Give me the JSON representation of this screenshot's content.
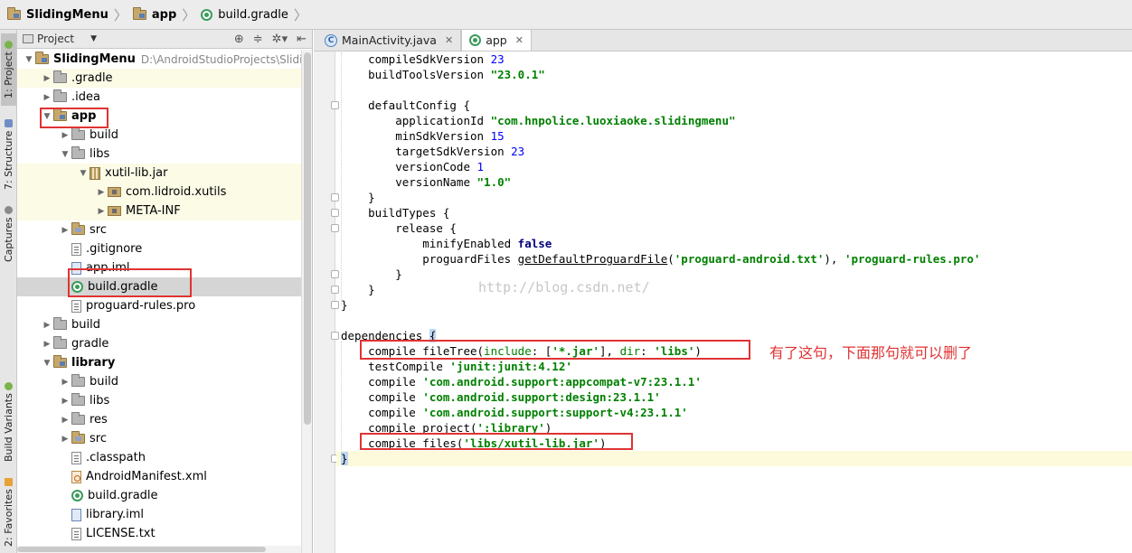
{
  "breadcrumb": {
    "items": [
      {
        "label": "SlidingMenu",
        "icon": "module-folder-icon"
      },
      {
        "label": "app",
        "icon": "module-folder-icon"
      },
      {
        "label": "build.gradle",
        "icon": "gradle-icon"
      }
    ]
  },
  "left_toolbar": {
    "tabs": [
      {
        "label": "1: Project",
        "active": true
      },
      {
        "label": "7: Structure"
      },
      {
        "label": "Captures"
      },
      {
        "label": "Build Variants"
      },
      {
        "label": "2: Favorites"
      }
    ]
  },
  "project_panel": {
    "view_selector": "Project",
    "tree": [
      {
        "label": "SlidingMenu",
        "path": "D:\\AndroidStudioProjects\\Sliding",
        "expanded": true,
        "bold": true,
        "icon": "module-folder-icon"
      },
      {
        "label": ".gradle",
        "icon": "folder-icon",
        "expanded": false
      },
      {
        "label": ".idea",
        "icon": "folder-icon",
        "expanded": false
      },
      {
        "label": "app",
        "icon": "module-folder-icon",
        "expanded": true,
        "bold": true
      },
      {
        "label": "build",
        "icon": "folder-icon",
        "expanded": false
      },
      {
        "label": "libs",
        "icon": "folder-icon",
        "expanded": true
      },
      {
        "label": "xutil-lib.jar",
        "icon": "jar-icon",
        "expanded": true
      },
      {
        "label": "com.lidroid.xutils",
        "icon": "package-icon",
        "expanded": false
      },
      {
        "label": "META-INF",
        "icon": "package-icon",
        "expanded": false
      },
      {
        "label": "src",
        "icon": "source-folder-icon",
        "expanded": false
      },
      {
        "label": ".gitignore",
        "icon": "text-file-icon"
      },
      {
        "label": "app.iml",
        "icon": "iml-file-icon"
      },
      {
        "label": "build.gradle",
        "icon": "gradle-icon",
        "selected": true
      },
      {
        "label": "proguard-rules.pro",
        "icon": "text-file-icon"
      },
      {
        "label": "build",
        "icon": "folder-icon",
        "expanded": false
      },
      {
        "label": "gradle",
        "icon": "folder-icon",
        "expanded": false
      },
      {
        "label": "library",
        "icon": "module-folder-icon",
        "expanded": true,
        "bold": true
      },
      {
        "label": "build",
        "icon": "folder-icon",
        "expanded": false
      },
      {
        "label": "libs",
        "icon": "folder-icon",
        "expanded": false
      },
      {
        "label": "res",
        "icon": "folder-icon",
        "expanded": false
      },
      {
        "label": "src",
        "icon": "source-folder-icon",
        "expanded": false
      },
      {
        "label": ".classpath",
        "icon": "text-file-icon"
      },
      {
        "label": "AndroidManifest.xml",
        "icon": "xml-file-icon"
      },
      {
        "label": "build.gradle",
        "icon": "gradle-icon"
      },
      {
        "label": "library.iml",
        "icon": "iml-file-icon"
      },
      {
        "label": "LICENSE.txt",
        "icon": "text-file-icon"
      }
    ]
  },
  "editor": {
    "tabs": [
      {
        "label": "MainActivity.java",
        "icon": "java-class-icon",
        "active": false
      },
      {
        "label": "app",
        "icon": "gradle-icon",
        "active": true
      }
    ],
    "code_lines": [
      "    compileSdkVersion 23",
      "    buildToolsVersion \"23.0.1\"",
      "",
      "    defaultConfig {",
      "        applicationId \"com.hnpolice.luoxiaoke.slidingmenu\"",
      "        minSdkVersion 15",
      "        targetSdkVersion 23",
      "        versionCode 1",
      "        versionName \"1.0\"",
      "    }",
      "    buildTypes {",
      "        release {",
      "            minifyEnabled false",
      "            proguardFiles getDefaultProguardFile('proguard-android.txt'), 'proguard-rules.pro'",
      "        }",
      "    }",
      "}",
      "",
      "dependencies {",
      "    compile fileTree(include: ['*.jar'], dir: 'libs')",
      "    testCompile 'junit:junit:4.12'",
      "    compile 'com.android.support:appcompat-v7:23.1.1'",
      "    compile 'com.android.support:design:23.1.1'",
      "    compile 'com.android.support:support-v4:23.1.1'",
      "    compile project(':library')",
      "    compile files('libs/xutil-lib.jar')",
      "}"
    ]
  },
  "watermark": "http://blog.csdn.net/",
  "annotation_note": "有了这句，下面那句就可以删了",
  "colors": {
    "annotation": "#e03333",
    "string": "#008000",
    "number": "#0000ff",
    "keyword": "#000080"
  }
}
